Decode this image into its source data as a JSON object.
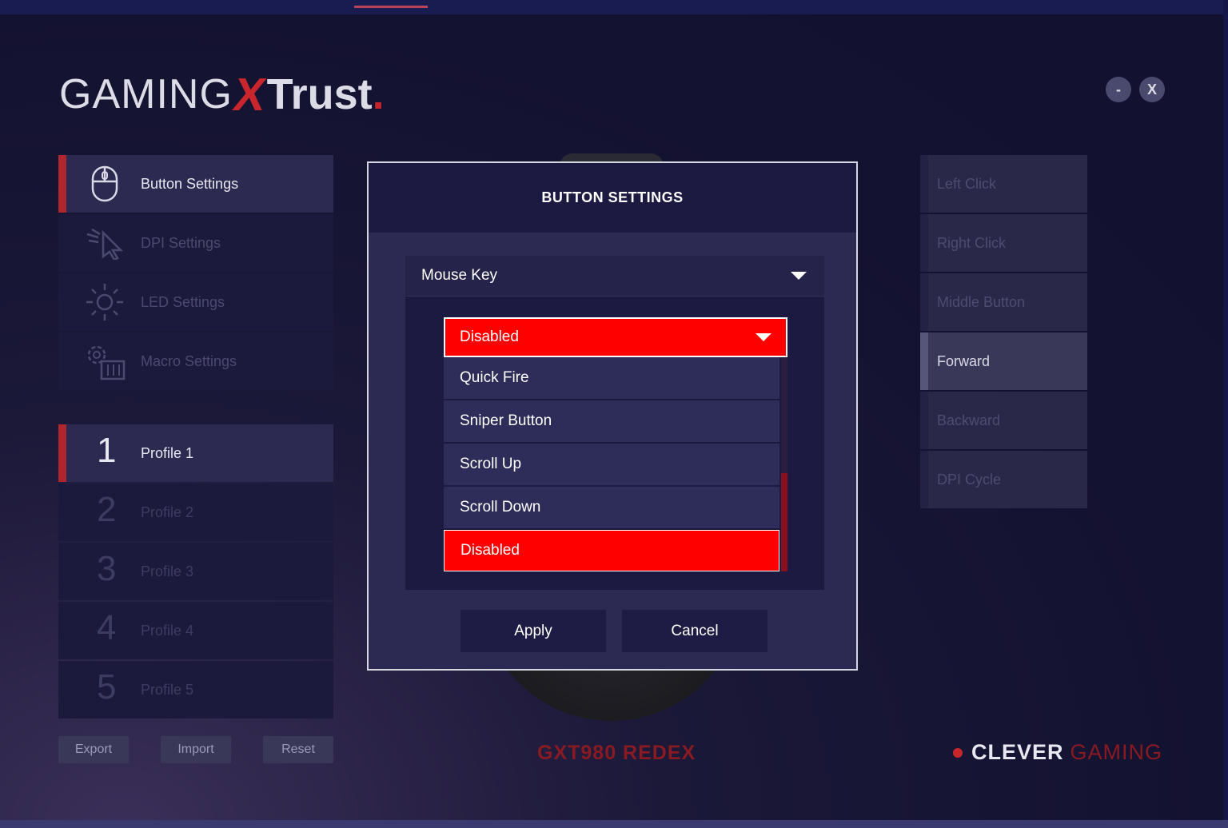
{
  "brand": {
    "gaming": "GAMING",
    "x": "X",
    "trust": "Trust",
    "dot": "."
  },
  "window": {
    "minimize": "-",
    "close": "X"
  },
  "nav": {
    "items": [
      {
        "label": "Button Settings",
        "icon": "mouse-icon",
        "active": true
      },
      {
        "label": "DPI Settings",
        "icon": "cursor-icon",
        "active": false
      },
      {
        "label": "LED Settings",
        "icon": "sun-icon",
        "active": false
      },
      {
        "label": "Macro Settings",
        "icon": "gear-sliders-icon",
        "active": false
      }
    ]
  },
  "profiles": [
    {
      "num": "1",
      "label": "Profile 1",
      "active": true
    },
    {
      "num": "2",
      "label": "Profile 2",
      "active": false
    },
    {
      "num": "3",
      "label": "Profile 3",
      "active": false
    },
    {
      "num": "4",
      "label": "Profile 4",
      "active": false
    },
    {
      "num": "5",
      "label": "Profile 5",
      "active": false
    }
  ],
  "footer": {
    "export": "Export",
    "import": "Import",
    "reset": "Reset"
  },
  "model": "GXT980 REDEX",
  "brand2": {
    "clever": "CLEVER",
    "gaming": "GAMING"
  },
  "buttons_list": [
    {
      "label": "Left Click",
      "active": false
    },
    {
      "label": "Right Click",
      "active": false
    },
    {
      "label": "Middle Button",
      "active": false
    },
    {
      "label": "Forward",
      "active": true
    },
    {
      "label": "Backward",
      "active": false
    },
    {
      "label": "DPI Cycle",
      "active": false
    }
  ],
  "modal": {
    "title": "BUTTON SETTINGS",
    "category_select": "Mouse Key",
    "function_select": "Disabled",
    "options": [
      {
        "label": "Quick Fire",
        "selected": false
      },
      {
        "label": "Sniper Button",
        "selected": false
      },
      {
        "label": "Scroll Up",
        "selected": false
      },
      {
        "label": "Scroll Down",
        "selected": false
      },
      {
        "label": "Disabled",
        "selected": true
      }
    ],
    "apply": "Apply",
    "cancel": "Cancel"
  },
  "colors": {
    "accent": "#ff0000",
    "brand_red": "#c8262c",
    "panel": "#2c2a52"
  }
}
